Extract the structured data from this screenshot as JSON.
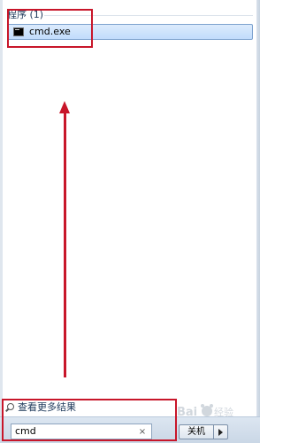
{
  "programs_section": {
    "header": "程序 (1)",
    "items": [
      {
        "label": "cmd.exe",
        "icon": "cmd-console-icon"
      }
    ]
  },
  "see_more_results": {
    "label": "查看更多结果",
    "icon": "search-icon"
  },
  "search": {
    "value": "cmd",
    "clear_glyph": "×"
  },
  "shutdown": {
    "label": "关机",
    "menu_icon": "triangle-right-icon"
  },
  "watermark_text": "Baidu 经验",
  "colors": {
    "annotation": "#c8162a",
    "selection_bg": "#c1dcfc",
    "selection_border": "#7da2ce",
    "text": "#1e395b"
  }
}
